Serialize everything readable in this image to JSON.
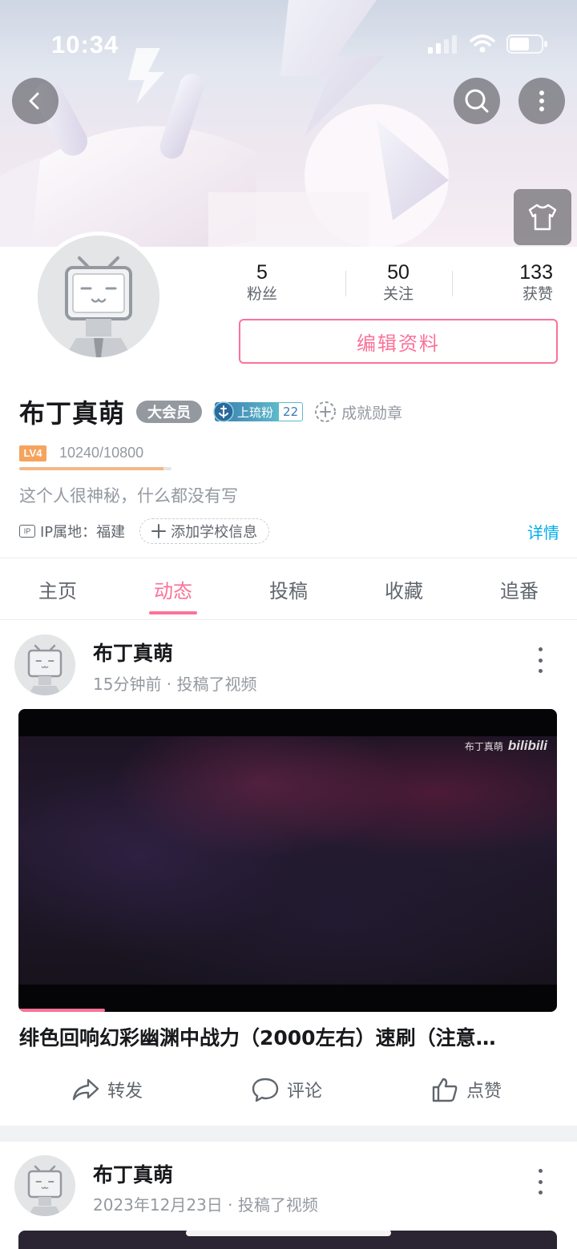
{
  "status_bar": {
    "time": "10:34"
  },
  "profile": {
    "stats": [
      {
        "value": "5",
        "label": "粉丝"
      },
      {
        "value": "50",
        "label": "关注"
      },
      {
        "value": "133",
        "label": "获赞"
      }
    ],
    "edit_button": "编辑资料",
    "username": "布丁真萌",
    "vip_label": "大会员",
    "fan_medal": {
      "name": "上琉粉",
      "level": "22"
    },
    "medal_link": "成就勋章",
    "level_tag": "LV4",
    "exp_text": "10240/10800",
    "exp_progress": 0.948,
    "signature": "这个人很神秘，什么都没有写",
    "ip_text": "IP属地：福建",
    "ip_tag": "IP",
    "school_button": "添加学校信息",
    "details_link": "详情"
  },
  "tabs": [
    {
      "label": "主页",
      "active": false
    },
    {
      "label": "动态",
      "active": true
    },
    {
      "label": "投稿",
      "active": false
    },
    {
      "label": "收藏",
      "active": false
    },
    {
      "label": "追番",
      "active": false
    }
  ],
  "feed": [
    {
      "author": "布丁真萌",
      "meta": "15分钟前 · 投稿了视频",
      "watermark_user": "布丁真萌",
      "watermark_brand": "bilibili",
      "video_progress": 0.16,
      "title": "绯色回响幻彩幽渊中战力（2000左右）速刷（注意…",
      "actions": {
        "share": "转发",
        "comment": "评论",
        "like": "点赞"
      }
    },
    {
      "author": "布丁真萌",
      "meta": "2023年12月23日 · 投稿了视频"
    }
  ],
  "colors": {
    "accent": "#fb7299",
    "link": "#00aeec",
    "muted": "#9499a0"
  }
}
